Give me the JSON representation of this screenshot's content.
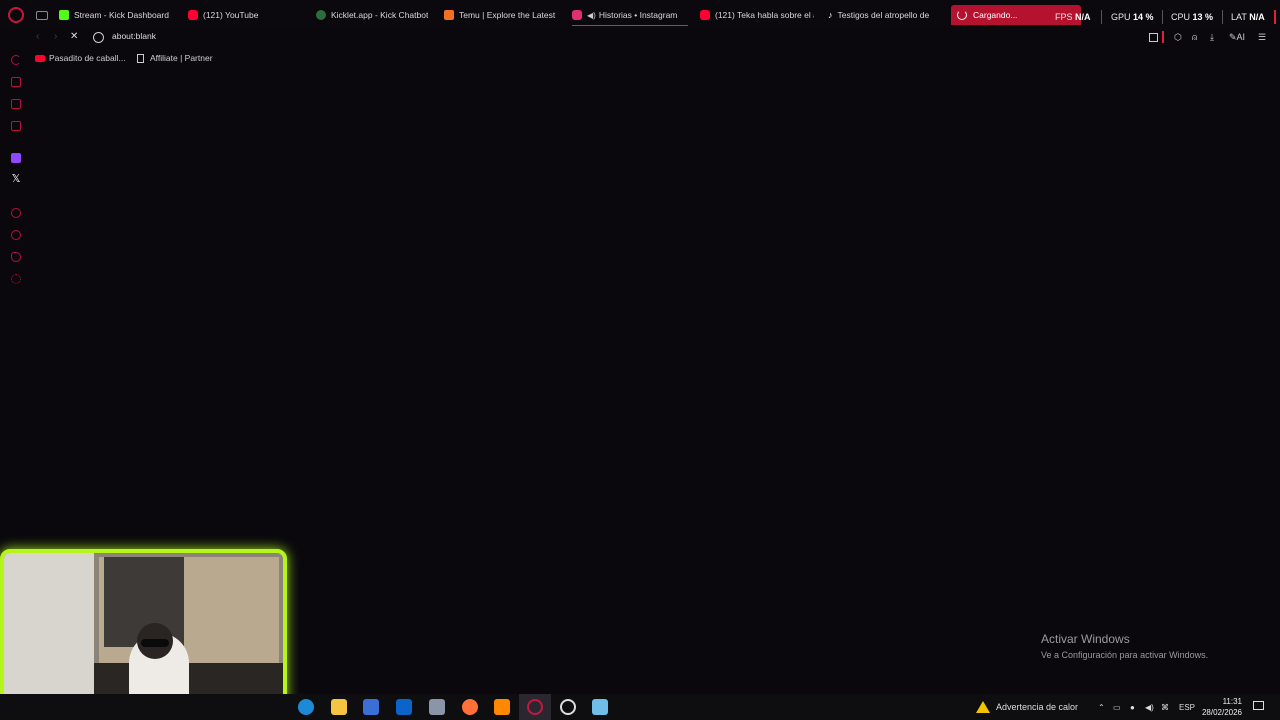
{
  "tabs": [
    {
      "title": "Stream - Kick Dashboard",
      "color": "#53fc18"
    },
    {
      "title": "(121) YouTube",
      "color": "#ff0033"
    },
    {
      "title": "Kicklet.app - Kick Chatbot",
      "color": "#2b6e3a"
    },
    {
      "title": "Temu | Explore the Latest",
      "color": "#f36f21"
    },
    {
      "title": "Historias • Instagram",
      "color": "#e1306c"
    },
    {
      "title": "(121) Teka habla sobre el a",
      "color": "#ff0033"
    },
    {
      "title": "Testigos del atropello de",
      "color": "#ffffff"
    },
    {
      "title": "Cargando...",
      "color": "#ffffff"
    }
  ],
  "stats": {
    "fps_label": "FPS",
    "fps_value": "N/A",
    "gpu_label": "GPU",
    "gpu_value": "14 %",
    "cpu_label": "CPU",
    "cpu_value": "13 %",
    "lat_label": "LAT",
    "lat_value": "N/A"
  },
  "address": {
    "url": "about:blank",
    "ai_label": "AI"
  },
  "bookmarks": [
    {
      "label": "Pasadito de caball...",
      "icon": "youtube-icon"
    },
    {
      "label": "Affiliate | Partner",
      "icon": "page-icon"
    }
  ],
  "sidebar_icons": [
    "refresh-icon",
    "store-icon",
    "chat-icon",
    "news-icon",
    "twitch-icon",
    "x-icon",
    "play-icon",
    "history-icon",
    "extensions-icon",
    "settings-icon"
  ],
  "watermark": {
    "line1": "Activar Windows",
    "line2": "Ve a Configuración para activar Windows."
  },
  "taskbar": {
    "heat_warning": "Advertencia de calor",
    "language": "ESP",
    "time": "11:31",
    "date": "28/02/2026",
    "apps": [
      "edge-icon",
      "explorer-icon",
      "store-icon",
      "outlook-icon",
      "app-icon",
      "firefox-icon",
      "vlc-icon",
      "opera-gx-icon",
      "speedtest-icon",
      "notepad-icon"
    ]
  },
  "colors": {
    "accent": "#e0205a",
    "webcam_border": "#b6f51a",
    "background": "#0a080d"
  }
}
